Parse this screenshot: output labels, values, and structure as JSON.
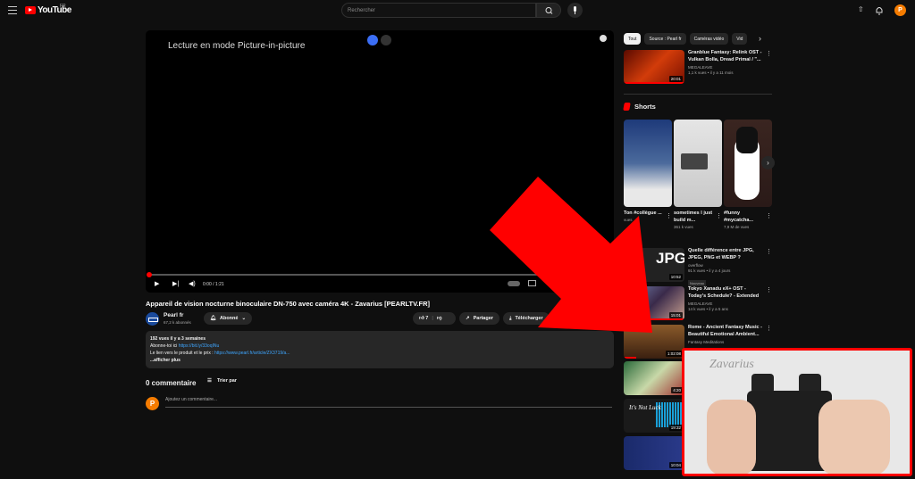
{
  "header": {
    "logo_text": "YouTube",
    "country_code": "FR",
    "search_placeholder": "Rechercher",
    "avatar_letter": "P"
  },
  "player": {
    "overlay_text": "Lecture en mode Picture-in-picture",
    "time": "0:00 / 1:21",
    "progress_fraction": 0.0
  },
  "video": {
    "title": "Appareil de vision nocturne binoculaire DN-750 avec caméra 4K - Zavarius [PEARLTV.FR]",
    "channel_name": "Pearl fr",
    "subscribers": "67,2 k abonnés",
    "subscribe_label": "Abonné",
    "likes": "7",
    "share_label": "Partager",
    "download_label": "Télécharger"
  },
  "description": {
    "stats": "192 vues  il y a 3 semaines",
    "line1_text": "Abonne-toi ici ",
    "line1_link": "https://bit.ly/33oqINu",
    "line2_text": "Le lien vers le produit et le prix : ",
    "line2_link": "https://www.pearl.fr/article/ZX3719/a...",
    "more": "...afficher plus"
  },
  "comments": {
    "count_label": "0 commentaire",
    "sort_label": "Trier par",
    "placeholder": "Ajoutez un commentaire...",
    "avatar_letter": "P"
  },
  "sidebar": {
    "chips": [
      "Tout",
      "Source : Pearl fr",
      "Caméras vidéo",
      "Vid"
    ],
    "videos": [
      {
        "title": "Granblue Fantasy: Relink OST - Vulkan Bolla, Dread Primal / \"...",
        "channel": "MEGALEAVE",
        "stats": "1,1 k vues • il y a 11 mois",
        "duration": "20:01"
      },
      {
        "title": "Quelle différence entre JPG, JPEG, PNG et WEBP ?",
        "channel": "overflow",
        "stats": "91 k vues • il y a 4 jours",
        "duration": "10:52",
        "badge": "Nouveau"
      },
      {
        "title": "Tokyo Xanadu eX+ OST - Today's Schedule? - Extended",
        "channel": "MEGALEAVE",
        "stats": "14 k vues • il y a 5 ans",
        "duration": "15:01"
      },
      {
        "title": "Rome - Ancient Fantasy Music - Beautiful Emotional Ambient...",
        "channel": "Fantasy Meditations",
        "stats": "",
        "duration": "1:02:08"
      }
    ],
    "thumb_durations": [
      "4:20",
      "19:32",
      "10:04"
    ],
    "shorts_title": "Shorts",
    "shorts": [
      {
        "title": "Ton #collègue ...",
        "views": "vues"
      },
      {
        "title": "sometimes I just build m...",
        "views": "361 k vues"
      },
      {
        "title": "#funny #mycatcha...",
        "views": "7,9 M de vues"
      }
    ]
  },
  "mini_player": {
    "watermark": "Zavarius"
  },
  "annotation": {
    "color": "#ff0000"
  }
}
